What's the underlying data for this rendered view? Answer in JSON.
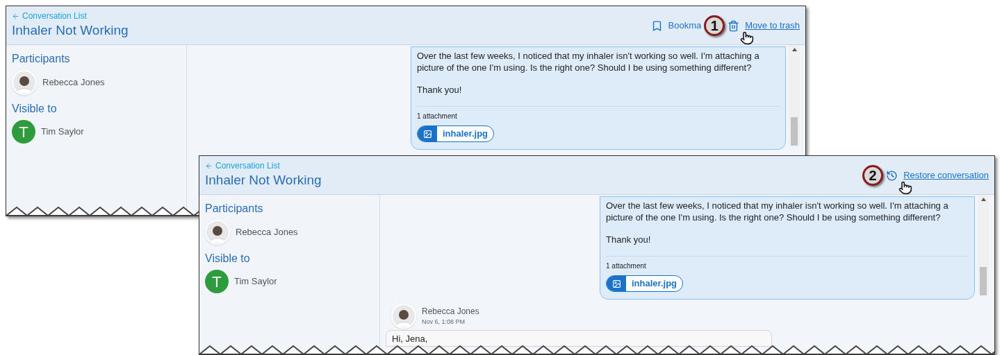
{
  "screens": [
    {
      "back_link": "Conversation List",
      "title": "Inhaler Not Working",
      "actions": [
        {
          "kind": "bookmark",
          "label": "Bookma",
          "pointer": false
        },
        {
          "kind": "callout",
          "label": "1",
          "pointer": false
        },
        {
          "kind": "trash",
          "label": "Move to trash",
          "pointer": true
        }
      ],
      "participants_heading": "Participants",
      "participants": [
        {
          "name": "Rebecca Jones"
        }
      ],
      "visible_to_heading": "Visible to",
      "visible_to": [
        {
          "initial": "T",
          "name": "Tim Saylor"
        }
      ],
      "messages": [
        {
          "kind": "bubble",
          "paragraphs": [
            "Over the last few weeks, I noticed that my inhaler isn't working so well. I'm attaching a picture of the one I'm using. Is the right one? Should I be using something different?",
            "Thank you!"
          ],
          "attachments_label": "1 attachment",
          "attachment": "inhaler.jpg"
        }
      ]
    },
    {
      "back_link": "Conversation List",
      "title": "Inhaler Not Working",
      "actions": [
        {
          "kind": "callout",
          "label": "2",
          "pointer": false
        },
        {
          "kind": "restore",
          "label": "Restore conversation",
          "pointer": true
        }
      ],
      "participants_heading": "Participants",
      "participants": [
        {
          "name": "Rebecca Jones"
        }
      ],
      "visible_to_heading": "Visible to",
      "visible_to": [
        {
          "initial": "T",
          "name": "Tim Saylor"
        }
      ],
      "messages": [
        {
          "kind": "bubble",
          "paragraphs": [
            "Over the last few weeks, I noticed that my inhaler isn't working so well. I'm attaching a picture of the one I'm using. Is the right one? Should I be using something different?",
            "Thank you!"
          ],
          "attachments_label": "1 attachment",
          "attachment": "inhaler.jpg"
        },
        {
          "kind": "reply",
          "author": "Rebecca Jones",
          "time": "Nov 6, 1:08 PM",
          "text": "Hi, Jena,"
        }
      ]
    }
  ]
}
